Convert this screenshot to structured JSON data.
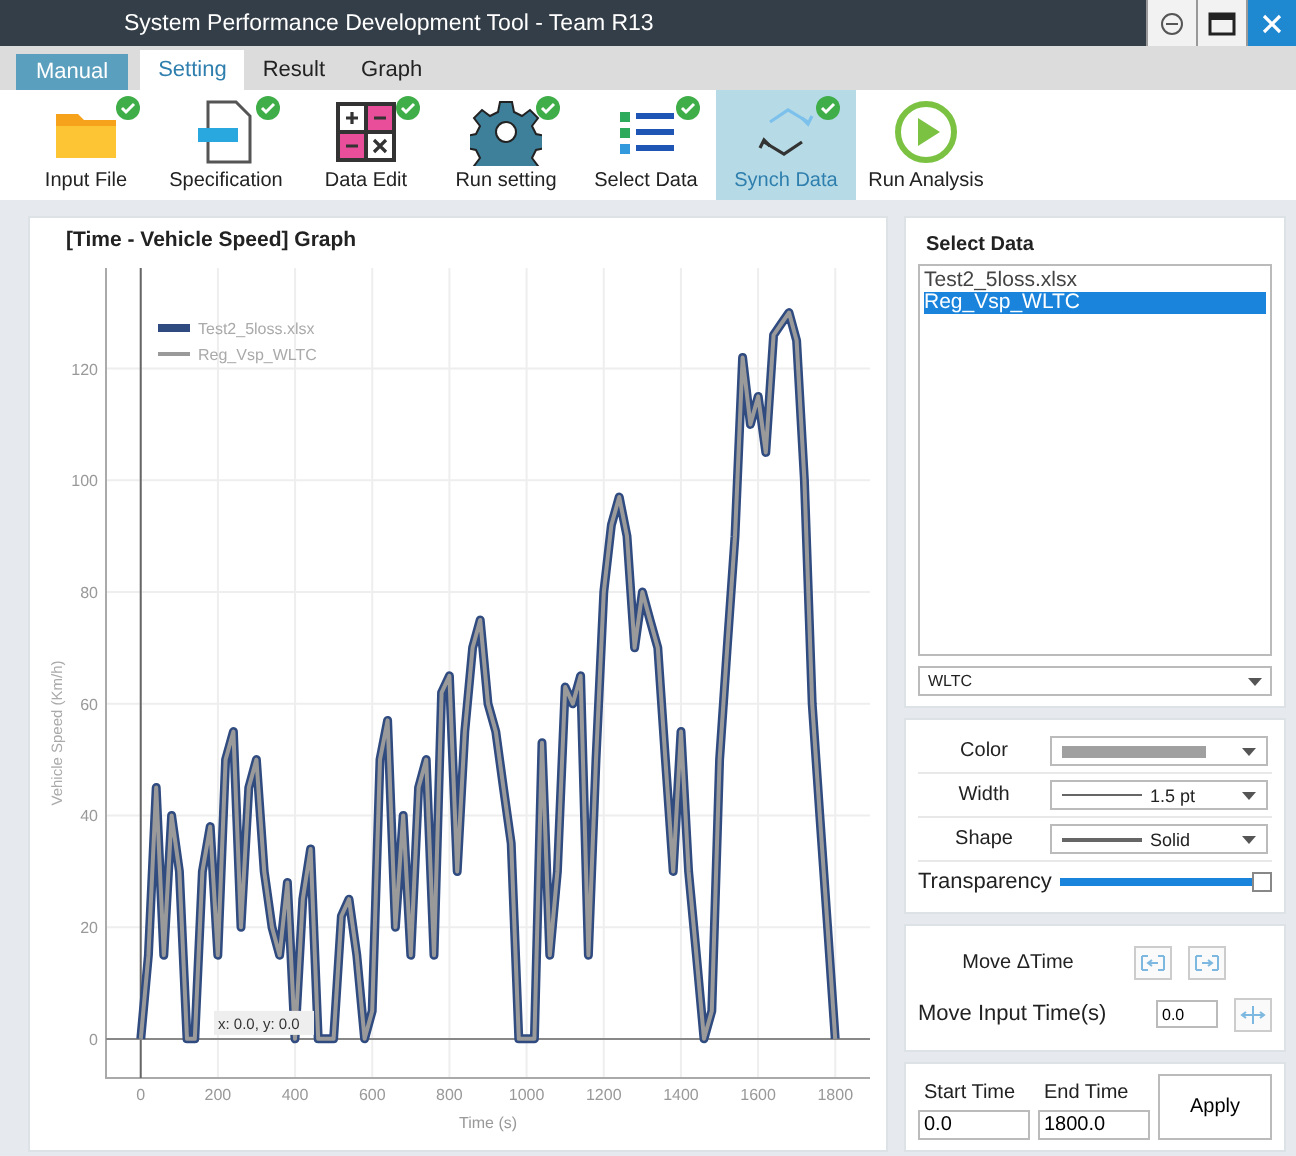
{
  "window": {
    "title": "System Performance Development Tool - Team R13"
  },
  "mode_button": {
    "label": "Manual"
  },
  "tabs": [
    {
      "label": "Setting",
      "selected": true
    },
    {
      "label": "Result",
      "selected": false
    },
    {
      "label": "Graph",
      "selected": false
    }
  ],
  "toolbar": [
    {
      "label": "Input File",
      "kind": "folder",
      "done": true,
      "selected": false
    },
    {
      "label": "Specification",
      "kind": "document",
      "done": true,
      "selected": false
    },
    {
      "label": "Data Edit",
      "kind": "calculator",
      "done": true,
      "selected": false
    },
    {
      "label": "Run setting",
      "kind": "gear",
      "done": true,
      "selected": false
    },
    {
      "label": "Select Data",
      "kind": "list",
      "done": true,
      "selected": false
    },
    {
      "label": "Synch Data",
      "kind": "sync",
      "done": true,
      "selected": true
    },
    {
      "label": "Run Analysis",
      "kind": "play",
      "done": false,
      "selected": false
    }
  ],
  "graph": {
    "title": "[Time - Vehicle Speed] Graph",
    "cursor_readout": "x: 0.0, y: 0.0",
    "chart_data": {
      "type": "line",
      "grid": true,
      "legend": true,
      "xlabel": "Time (s)",
      "ylabel": "Vehicle Speed (Km/h)",
      "xlim": [
        -90,
        1890
      ],
      "ylim": [
        -7,
        138
      ],
      "xticks": [
        0,
        200,
        400,
        600,
        800,
        1000,
        1200,
        1400,
        1600,
        1800
      ],
      "yticks": [
        0,
        20,
        40,
        60,
        80,
        100,
        120
      ],
      "x": [
        0,
        20,
        40,
        60,
        80,
        100,
        120,
        140,
        160,
        180,
        200,
        220,
        240,
        260,
        280,
        300,
        320,
        340,
        360,
        380,
        400,
        420,
        440,
        460,
        480,
        500,
        520,
        540,
        560,
        580,
        600,
        620,
        640,
        660,
        680,
        700,
        720,
        740,
        760,
        780,
        800,
        820,
        840,
        860,
        880,
        900,
        920,
        940,
        960,
        980,
        1000,
        1020,
        1040,
        1060,
        1080,
        1100,
        1120,
        1140,
        1160,
        1180,
        1200,
        1220,
        1240,
        1260,
        1280,
        1300,
        1320,
        1340,
        1360,
        1380,
        1400,
        1420,
        1440,
        1460,
        1480,
        1500,
        1520,
        1540,
        1560,
        1580,
        1600,
        1620,
        1640,
        1660,
        1680,
        1700,
        1720,
        1740,
        1760,
        1780,
        1800
      ],
      "series": [
        {
          "name": "Test2_5loss.xlsx",
          "color": "#2f4b80",
          "values": [
            0,
            15,
            45,
            15,
            40,
            30,
            0,
            0,
            30,
            38,
            15,
            50,
            55,
            20,
            45,
            50,
            30,
            20,
            15,
            28,
            0,
            25,
            34,
            0,
            0,
            0,
            22,
            25,
            15,
            0,
            5,
            50,
            57,
            20,
            40,
            15,
            45,
            50,
            15,
            62,
            65,
            30,
            55,
            70,
            75,
            60,
            55,
            45,
            35,
            0,
            0,
            0,
            53,
            15,
            30,
            63,
            60,
            65,
            15,
            50,
            80,
            92,
            97,
            90,
            70,
            80,
            75,
            70,
            50,
            30,
            55,
            30,
            15,
            0,
            5,
            50,
            70,
            90,
            122,
            110,
            115,
            105,
            126,
            128,
            130,
            125,
            100,
            60,
            40,
            20,
            0
          ]
        },
        {
          "name": "Reg_Vsp_WLTC",
          "color": "#9a9a9a",
          "values": [
            0,
            15,
            45,
            15,
            40,
            30,
            0,
            0,
            30,
            38,
            15,
            50,
            55,
            20,
            45,
            50,
            30,
            20,
            15,
            28,
            0,
            25,
            34,
            0,
            0,
            0,
            22,
            25,
            15,
            0,
            5,
            50,
            57,
            20,
            40,
            15,
            45,
            50,
            15,
            62,
            65,
            30,
            55,
            70,
            75,
            60,
            55,
            45,
            35,
            0,
            0,
            0,
            53,
            15,
            30,
            63,
            60,
            65,
            15,
            50,
            80,
            92,
            97,
            90,
            70,
            80,
            75,
            70,
            50,
            30,
            55,
            30,
            15,
            0,
            5,
            50,
            70,
            90,
            122,
            110,
            115,
            105,
            126,
            128,
            130,
            125,
            100,
            60,
            40,
            20,
            0
          ]
        }
      ]
    }
  },
  "select_data": {
    "title": "Select Data",
    "items": [
      {
        "label": "Test2_5loss.xlsx",
        "selected": false
      },
      {
        "label": "Reg_Vsp_WLTC",
        "selected": true
      }
    ],
    "filter": {
      "value": "WLTC"
    }
  },
  "line_style": {
    "color": {
      "label": "Color",
      "color": "#a0a0a0"
    },
    "width": {
      "label": "Width",
      "value": "1.5 pt"
    },
    "shape": {
      "label": "Shape",
      "value": "Solid"
    },
    "transparency": {
      "label": "Transparency",
      "level": 1.0
    }
  },
  "time_shift": {
    "move_label": "Move ΔTime",
    "input_label": "Move Input Time(s)",
    "input_value": "0.0"
  },
  "range": {
    "start_label": "Start Time",
    "start_value": "0.0",
    "end_label": "End Time",
    "end_value": "1800.0",
    "apply": "Apply"
  }
}
